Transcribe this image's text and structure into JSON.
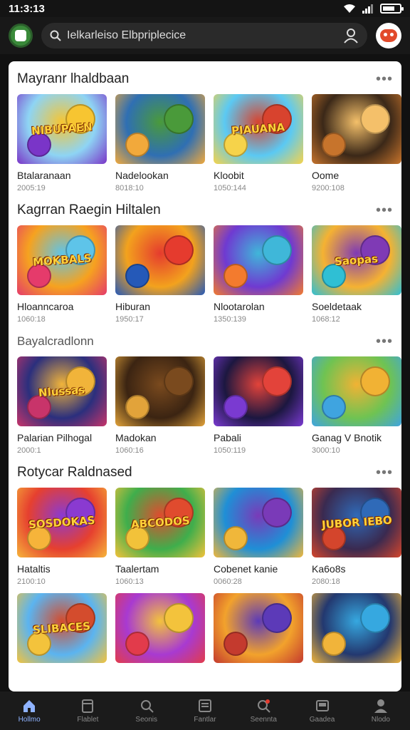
{
  "status": {
    "time": "11:3:13"
  },
  "search": {
    "placeholder": "Ielkarleiso Elbpriplecice"
  },
  "sections": [
    {
      "title": "Mayranr lhaldbaan",
      "cards": [
        {
          "title": "Btalaranaan",
          "sub": "2005:19",
          "art": "NIBUPAEN",
          "colors": [
            "#8ed4f4",
            "#7a35c8",
            "#f7c531"
          ]
        },
        {
          "title": "Nadelookan",
          "sub": "8018:10",
          "art": "",
          "colors": [
            "#2f6fb3",
            "#f2a93b",
            "#4a9a3a"
          ]
        },
        {
          "title": "Kloobit",
          "sub": "1050:144",
          "art": "PIAUANA",
          "colors": [
            "#5bc9f3",
            "#f6d34a",
            "#d8432e"
          ]
        },
        {
          "title": "Oome",
          "sub": "9200:108",
          "art": "",
          "colors": [
            "#3b2818",
            "#c7742c",
            "#f4c06a"
          ]
        }
      ]
    },
    {
      "title": "Kagrran Raegin Hiltalen",
      "cards": [
        {
          "title": "Hloanncaroa",
          "sub": "1060:18",
          "art": "MOKBALS",
          "colors": [
            "#f6a21f",
            "#e53b6b",
            "#5ec4e9"
          ]
        },
        {
          "title": "Hiburan",
          "sub": "1950:17",
          "art": "",
          "colors": [
            "#f3a21d",
            "#2559b8",
            "#e53b2e"
          ]
        },
        {
          "title": "Nlootarolan",
          "sub": "1350:139",
          "art": "",
          "colors": [
            "#6f3ad1",
            "#f37b2e",
            "#3fb7d9"
          ]
        },
        {
          "title": "Soeldetaak",
          "sub": "1068:12",
          "art": "Saopas",
          "colors": [
            "#f5b232",
            "#2fbfd4",
            "#7f3ab5"
          ]
        }
      ]
    },
    {
      "title": "Bayalcradlonn",
      "titleSmall": true,
      "cards": [
        {
          "title": "Palarian Pilhogal",
          "sub": "2000:1",
          "art": "Nlussas",
          "colors": [
            "#2b2f7d",
            "#c8346a",
            "#f1b43a"
          ]
        },
        {
          "title": "Madokan",
          "sub": "1060:16",
          "art": "",
          "colors": [
            "#3b2412",
            "#e2a33a",
            "#7a4a1e"
          ]
        },
        {
          "title": "Pabali",
          "sub": "1050:119",
          "art": "",
          "colors": [
            "#1c1740",
            "#7a3ad1",
            "#e3433a"
          ]
        },
        {
          "title": "Ganag V Bnotik",
          "sub": "3000:10",
          "art": "",
          "colors": [
            "#6fc352",
            "#3fa4e0",
            "#f1b234"
          ]
        }
      ]
    },
    {
      "title": "Rotycar Raldnased",
      "cards": [
        {
          "title": "Hataltis",
          "sub": "2100:10",
          "art": "SOSDOKAS",
          "colors": [
            "#e6402f",
            "#f6b43a",
            "#8a3ad1"
          ]
        },
        {
          "title": "Taalertam",
          "sub": "1060:13",
          "art": "ABCODOS",
          "colors": [
            "#3fae4c",
            "#f2c23a",
            "#e04b2e"
          ]
        },
        {
          "title": "Cobenet kanie",
          "sub": "0060:28",
          "art": "",
          "colors": [
            "#1f8fd6",
            "#f0b73a",
            "#7a3ab8"
          ]
        },
        {
          "title": "Ka6o8s",
          "sub": "2080:18",
          "art": "JUBOR IEBO",
          "colors": [
            "#3a2a50",
            "#d4452c",
            "#2f6ab8"
          ]
        }
      ]
    },
    {
      "title": "",
      "cards": [
        {
          "title": "",
          "sub": "",
          "art": "SLIBACES",
          "colors": [
            "#5bb4f0",
            "#f3c33c",
            "#d44c2d"
          ]
        },
        {
          "title": "",
          "sub": "",
          "art": "",
          "colors": [
            "#a83ad1",
            "#e23b4b",
            "#f3c33c"
          ]
        },
        {
          "title": "",
          "sub": "",
          "art": "",
          "colors": [
            "#f2a22c",
            "#c43a2e",
            "#5c3ab8"
          ]
        },
        {
          "title": "",
          "sub": "",
          "art": "",
          "colors": [
            "#23386f",
            "#f1b43a",
            "#36a8e0"
          ]
        }
      ]
    }
  ],
  "nav": [
    {
      "label": "Hollmo",
      "icon": "home-icon",
      "active": true
    },
    {
      "label": "Flablet",
      "icon": "tablet-icon",
      "active": false
    },
    {
      "label": "Seonis",
      "icon": "search-icon",
      "active": false
    },
    {
      "label": "Fantlar",
      "icon": "list-icon",
      "active": false
    },
    {
      "label": "Seennta",
      "icon": "notification-search-icon",
      "active": false
    },
    {
      "label": "Gaadea",
      "icon": "library-icon",
      "active": false
    },
    {
      "label": "Nlodo",
      "icon": "profile-icon",
      "active": false
    }
  ]
}
